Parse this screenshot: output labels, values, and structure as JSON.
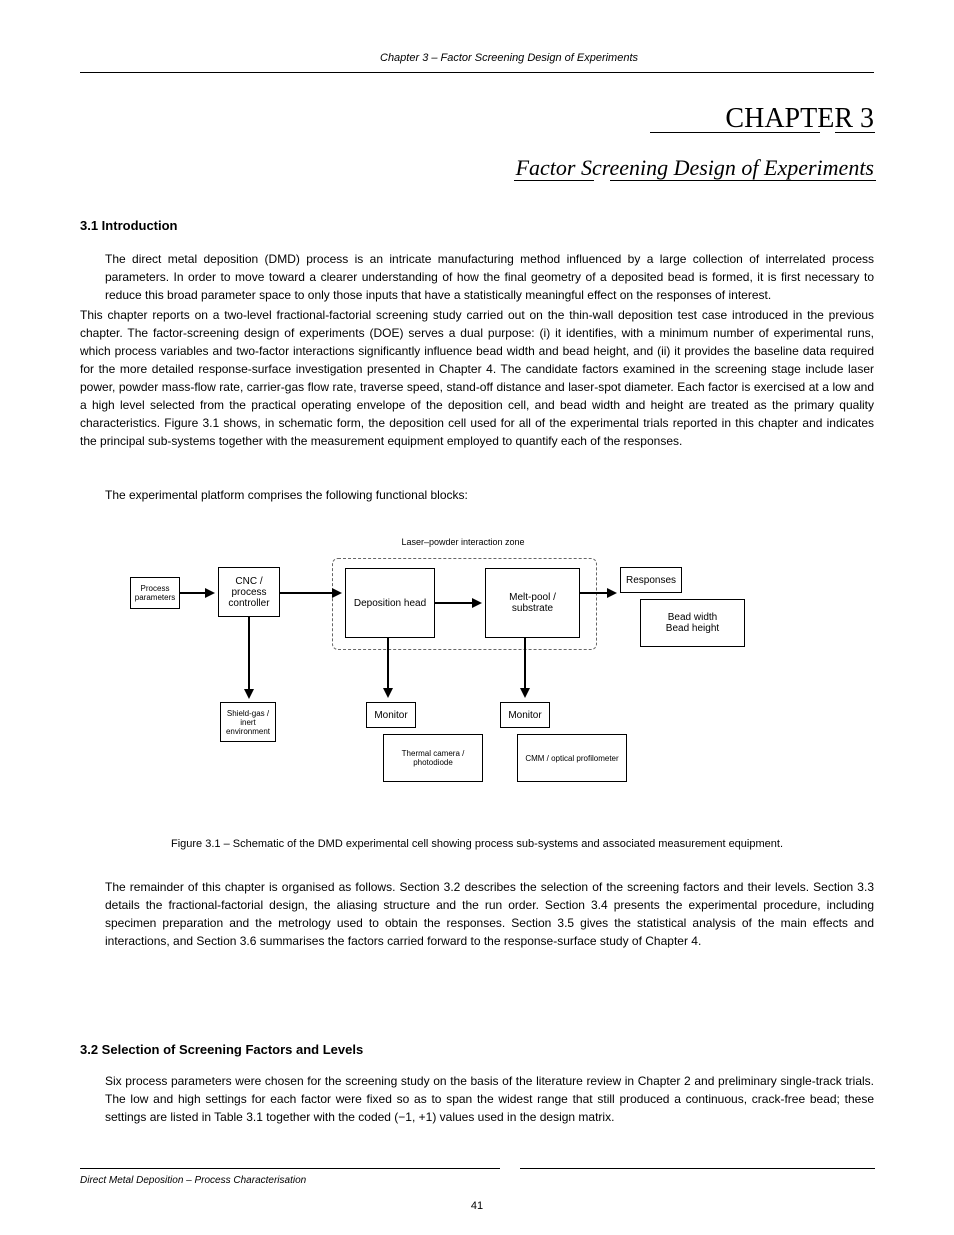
{
  "header": {
    "running": "Chapter 3 – Factor Screening Design of Experiments",
    "chapterNum": "CHAPTER 3",
    "chapterTitle": "Factor Screening Design of Experiments"
  },
  "section": {
    "num_title": "3.1 Introduction",
    "para1": "The direct metal deposition (DMD) process is an intricate manufacturing method influenced by a large collection of interrelated process parameters. In order to move toward a clearer understanding of how the final geometry of a deposited bead is formed, it is first necessary to reduce this broad parameter space to only those inputs that have a statistically meaningful effect on the responses of interest.",
    "para2": "This chapter reports on a two-level fractional-factorial screening study carried out on the thin-wall deposition test case introduced in the previous chapter. The factor-screening design of experiments (DOE) serves a dual purpose: (i) it identifies, with a minimum number of experimental runs, which process variables and two-factor interactions significantly influence bead width and bead height, and (ii) it provides the baseline data required for the more detailed response-surface investigation presented in Chapter 4. The candidate factors examined in the screening stage include laser power, powder mass-flow rate, carrier-gas flow rate, traverse speed, stand-off distance and laser-spot diameter. Each factor is exercised at a low and a high level selected from the practical operating envelope of the deposition cell, and bead width and height are treated as the primary quality characteristics. Figure 3.1 shows, in schematic form, the deposition cell used for all of the experimental trials reported in this chapter and indicates the principal sub-systems together with the measurement equipment employed to quantify each of the responses.",
    "para3_lead": "The experimental platform comprises the following functional blocks:",
    "para4_body": ""
  },
  "diagram": {
    "input": "Process parameters",
    "controller": "CNC / process controller",
    "head": "Deposition head",
    "melt": "Melt-pool / substrate",
    "responses_label": "Responses",
    "responses_items": "Bead width\nBead height",
    "meas1_label": "Monitor",
    "meas1_items": "Thermal camera / photodiode",
    "meas2_label": "Monitor",
    "meas2_items": "CMM / optical profilometer",
    "env": "Shield-gas / inert environment",
    "group_label": "Laser–powder interaction zone"
  },
  "caption": "Figure 3.1 – Schematic of the DMD experimental cell showing process sub-systems and associated measurement equipment.",
  "para5": "The remainder of this chapter is organised as follows. Section 3.2 describes the selection of the screening factors and their levels. Section 3.3 details the fractional-factorial design, the aliasing structure and the run order. Section 3.4 presents the experimental procedure, including specimen preparation and the metrology used to obtain the responses. Section 3.5 gives the statistical analysis of the main effects and interactions, and Section 3.6 summarises the factors carried forward to the response-surface study of Chapter 4.",
  "subsection": {
    "heading": "3.2 Selection of Screening Factors and Levels",
    "para": "Six process parameters were chosen for the screening study on the basis of the literature review in Chapter 2 and preliminary single-track trials. The low and high settings for each factor were fixed so as to span the widest range that still produced a continuous, crack-free bead; these settings are listed in Table 3.1 together with the coded (−1, +1) values used in the design matrix."
  },
  "footer": {
    "left": "Direct Metal Deposition – Process Characterisation",
    "right": "",
    "page": "41"
  }
}
